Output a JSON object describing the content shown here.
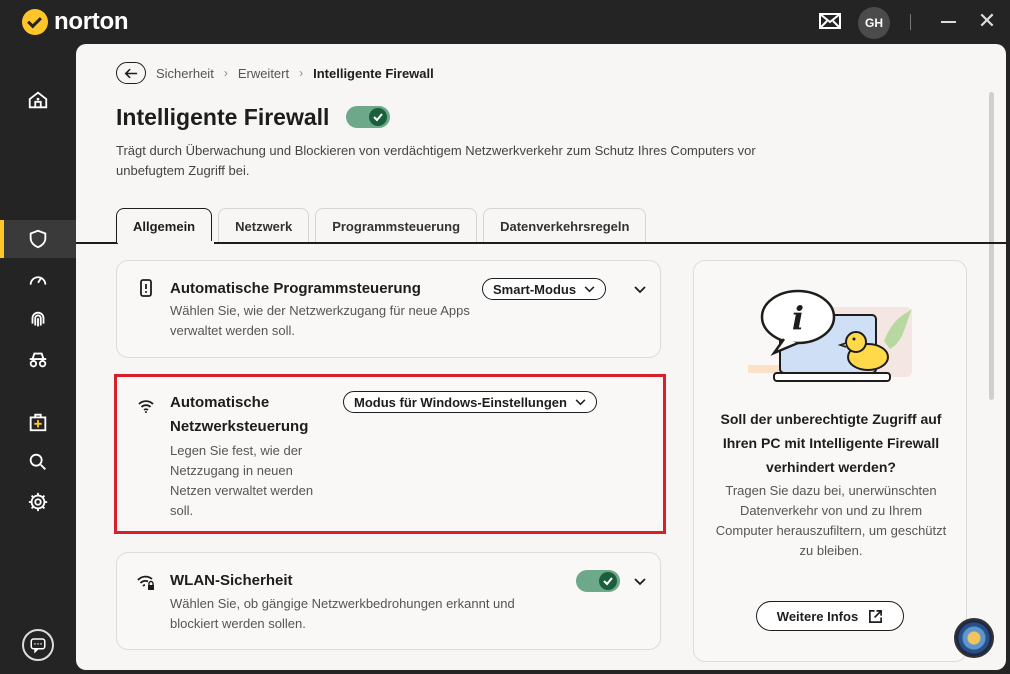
{
  "app": {
    "brand": "norton",
    "avatar_initials": "GH"
  },
  "breadcrumb": {
    "items": [
      "Sicherheit",
      "Erweitert"
    ],
    "current": "Intelligente Firewall"
  },
  "page": {
    "title": "Intelligente Firewall",
    "enabled": true,
    "description": "Trägt durch Überwachung und Blockieren von verdächtigem Netzwerkverkehr zum Schutz Ihres Computers vor unbefugtem Zugriff bei."
  },
  "tabs": [
    {
      "label": "Allgemein",
      "active": true
    },
    {
      "label": "Netzwerk",
      "active": false
    },
    {
      "label": "Programmsteuerung",
      "active": false
    },
    {
      "label": "Datenverkehrsregeln",
      "active": false
    }
  ],
  "settings": {
    "program_control": {
      "title": "Automatische Programmsteuerung",
      "description": "Wählen Sie, wie der Netzwerkzugang für neue Apps verwaltet werden soll.",
      "value": "Smart-Modus"
    },
    "network_control": {
      "title": "Automatische Netzwerksteuerung",
      "description": "Legen Sie fest, wie der Netzzugang in neuen Netzen verwaltet werden soll.",
      "value": "Modus für Windows-Einstellungen"
    },
    "wifi_security": {
      "title": "WLAN-Sicherheit",
      "description": "Wählen Sie, ob gängige Netzwerkbedrohungen erkannt und blockiert werden sollen.",
      "enabled": true
    }
  },
  "side_panel": {
    "title": "Soll der unberechtigte Zugriff auf Ihren PC mit Intelligente Firewall verhindert werden?",
    "description": "Tragen Sie dazu bei, unerwünschten Datenverkehr von und zu Ihrem Computer herauszufiltern, um geschützt zu bleiben.",
    "button_label": "Weitere Infos"
  },
  "colors": {
    "brand": "#ffc629",
    "toggle_on": "#6ea88a",
    "highlight": "#d6202a"
  },
  "icons": [
    "mail-icon",
    "home-icon",
    "shield-icon",
    "speedometer-icon",
    "fingerprint-icon",
    "incognito-icon",
    "health-kit-icon",
    "search-icon",
    "gear-icon",
    "chat-icon",
    "phone-icon",
    "wifi-icon",
    "wifi-lock-icon",
    "external-link-icon"
  ]
}
